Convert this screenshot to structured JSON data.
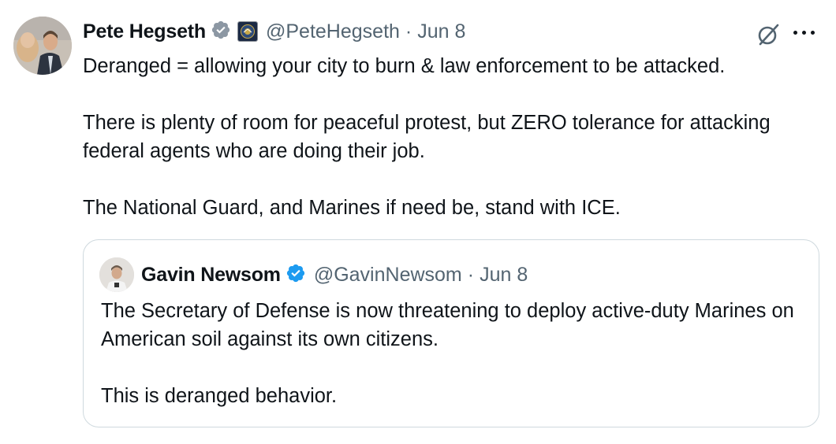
{
  "tweet": {
    "author_name": "Pete Hegseth",
    "handle": "@PeteHegseth",
    "separator": "·",
    "date": "Jun 8",
    "paragraphs": [
      "Deranged = allowing your city to burn & law enforcement to be attacked.",
      "There is plenty of room for peaceful protest, but ZERO tolerance for attacking federal agents who are doing their job.",
      "The National Guard, and Marines if need be, stand with ICE."
    ],
    "badge_color": "#8c97a3",
    "icons": {
      "verified": "gray-verified-badge-icon",
      "affiliation": "dod-seal-icon",
      "grok": "grok-icon",
      "more": "more-options-icon"
    }
  },
  "quote": {
    "author_name": "Gavin Newsom",
    "handle": "@GavinNewsom",
    "separator": "·",
    "date": "Jun 8",
    "paragraphs": [
      "The Secretary of Defense is now threatening to deploy active-duty Marines on American soil against its own citizens.",
      "This is deranged behavior."
    ],
    "badge_color": "#1d9bf0",
    "icons": {
      "verified": "blue-verified-badge-icon"
    }
  },
  "colors": {
    "text": "#0f1419",
    "secondary": "#536471",
    "border": "#cfd9de"
  }
}
